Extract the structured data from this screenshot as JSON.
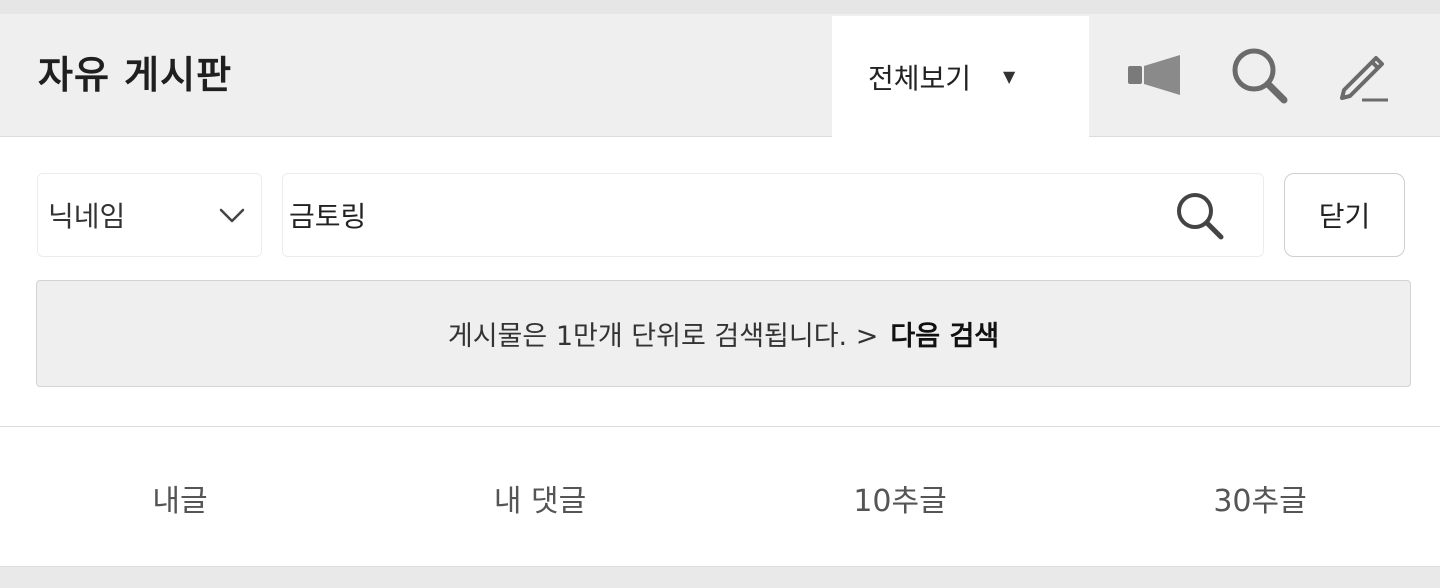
{
  "header": {
    "title": "자유 게시판",
    "view_filter": {
      "selected": "전체보기",
      "caret_icon": "triangle-down-icon"
    },
    "icons": [
      "megaphone-icon",
      "search-icon",
      "pencil-icon"
    ]
  },
  "search": {
    "field_select": {
      "selected": "닉네임",
      "chevron_icon": "chevron-down-icon"
    },
    "query": {
      "value": "금토링"
    },
    "submit_icon": "search-icon",
    "close_label": "닫기"
  },
  "notice": {
    "text": "게시물은 1만개 단위로 검색됩니다. >",
    "next_link": "다음 검색"
  },
  "tabs": [
    {
      "label": "내글"
    },
    {
      "label": "내 댓글"
    },
    {
      "label": "10추글"
    },
    {
      "label": "30추글"
    }
  ],
  "colors": {
    "header_bg": "#efeff0",
    "notice_bg": "#efefef",
    "icon_color": "#6b6b6b"
  }
}
